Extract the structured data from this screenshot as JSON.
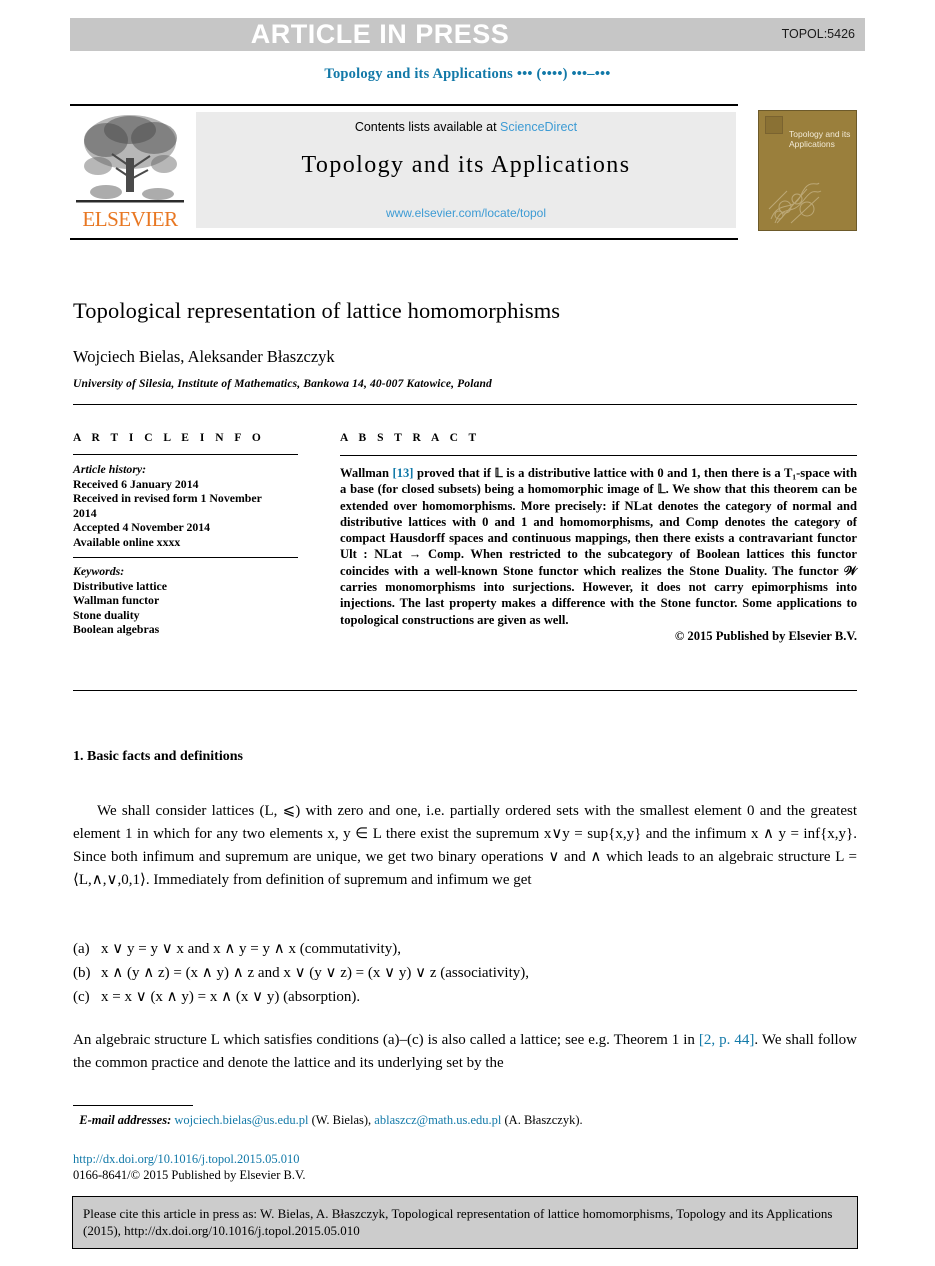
{
  "banner": {
    "label": "ARTICLE IN PRESS",
    "code": "TOPOL:5426",
    "bar_color": "#c6c6c6"
  },
  "running_head": "Topology and its Applications ••• (••••) •••–•••",
  "masthead": {
    "contents_prefix": "Contents lists available at ",
    "contents_link": "ScienceDirect",
    "journal_title": "Topology and its Applications",
    "journal_url": "www.elsevier.com/locate/topol",
    "publisher_logo_text": "ELSEVIER",
    "publisher_color": "#e87722",
    "link_color": "#3d9bd4",
    "cover_title": "Topology and its Applications",
    "cover_color": "#9a7f3c"
  },
  "article": {
    "title": "Topological representation of lattice homomorphisms",
    "authors": "Wojciech Bielas, Aleksander Błaszczyk",
    "affiliation": "University of Silesia, Institute of Mathematics, Bankowa 14, 40-007 Katowice, Poland"
  },
  "info": {
    "heading": "A R T I C L E   I N F O",
    "history_label": "Article history:",
    "history": [
      "Received 6 January 2014",
      "Received in revised form 1 November",
      "2014",
      "Accepted 4 November 2014",
      "Available online xxxx"
    ],
    "keywords_label": "Keywords:",
    "keywords": [
      "Distributive lattice",
      "Wallman functor",
      "Stone duality",
      "Boolean algebras"
    ]
  },
  "abstract": {
    "heading": "A B S T R A C T",
    "ref_tag": "[13]",
    "text_before_ref": "Wallman ",
    "text_after_ref": " proved that if 𝕃 is a distributive lattice with 0 and 1, then there is a T₁-space with a base (for closed subsets) being a homomorphic image of 𝕃. We show that this theorem can be extended over homomorphisms. More precisely: if NLat denotes the category of normal and distributive lattices with 0 and 1 and homomorphisms, and Comp denotes the category of compact Hausdorff spaces and continuous mappings, then there exists a contravariant functor Ult : NLat → Comp. When restricted to the subcategory of Boolean lattices this functor coincides with a well-known Stone functor which realizes the Stone Duality. The functor 𝒲 carries monomorphisms into surjections. However, it does not carry epimorphisms into injections. The last property makes a difference with the Stone functor. Some applications to topological constructions are given as well.",
    "copyright": "© 2015 Published by Elsevier B.V."
  },
  "body": {
    "section_number_title": "1. Basic facts and definitions",
    "paragraph_1": "We shall consider lattices (L, ⩽) with zero and one, i.e. partially ordered sets with the smallest element 0 and the greatest element 1 in which for any two elements x, y ∈ L there exist the supremum x∨y = sup{x,y} and the infimum x ∧ y = inf{x,y}. Since both infimum and supremum are unique, we get two binary operations ∨ and ∧ which leads to an algebraic structure L = ⟨L,∧,∨,0,1⟩. Immediately from definition of supremum and infimum we get",
    "list": [
      {
        "label": "(a)",
        "text": "x ∨ y = y ∨ x and x ∧ y = y ∧ x (commutativity),"
      },
      {
        "label": "(b)",
        "text": "x ∧ (y ∧ z) = (x ∧ y) ∧ z and x ∨ (y ∨ z) = (x ∨ y) ∨ z (associativity),"
      },
      {
        "label": "(c)",
        "text": "x = x ∨ (x ∧ y) = x ∧ (x ∨ y) (absorption)."
      }
    ],
    "paragraph_2_before": "An algebraic structure L which satisfies conditions (a)–(c) is also called a lattice; see e.g. Theorem 1 in ",
    "paragraph_2_ref": "[2, p. 44]",
    "paragraph_2_after": ". We shall follow the common practice and denote the lattice and its underlying set by the"
  },
  "footer": {
    "email_label": "E-mail addresses:",
    "email_1": "wojciech.bielas@us.edu.pl",
    "email_1_who": " (W. Bielas), ",
    "email_2": "ablaszcz@math.us.edu.pl",
    "email_2_who": " (A. Błaszczyk).",
    "doi": "http://dx.doi.org/10.1016/j.topol.2015.05.010",
    "issn": "0166-8641/© 2015 Published by Elsevier B.V.",
    "link_color": "#1279a8"
  },
  "cite_box": {
    "text": "Please cite this article in press as: W. Bielas, A. Błaszczyk, Topological representation of lattice homomorphisms, Topology and its Applications (2015), http://dx.doi.org/10.1016/j.topol.2015.05.010"
  }
}
